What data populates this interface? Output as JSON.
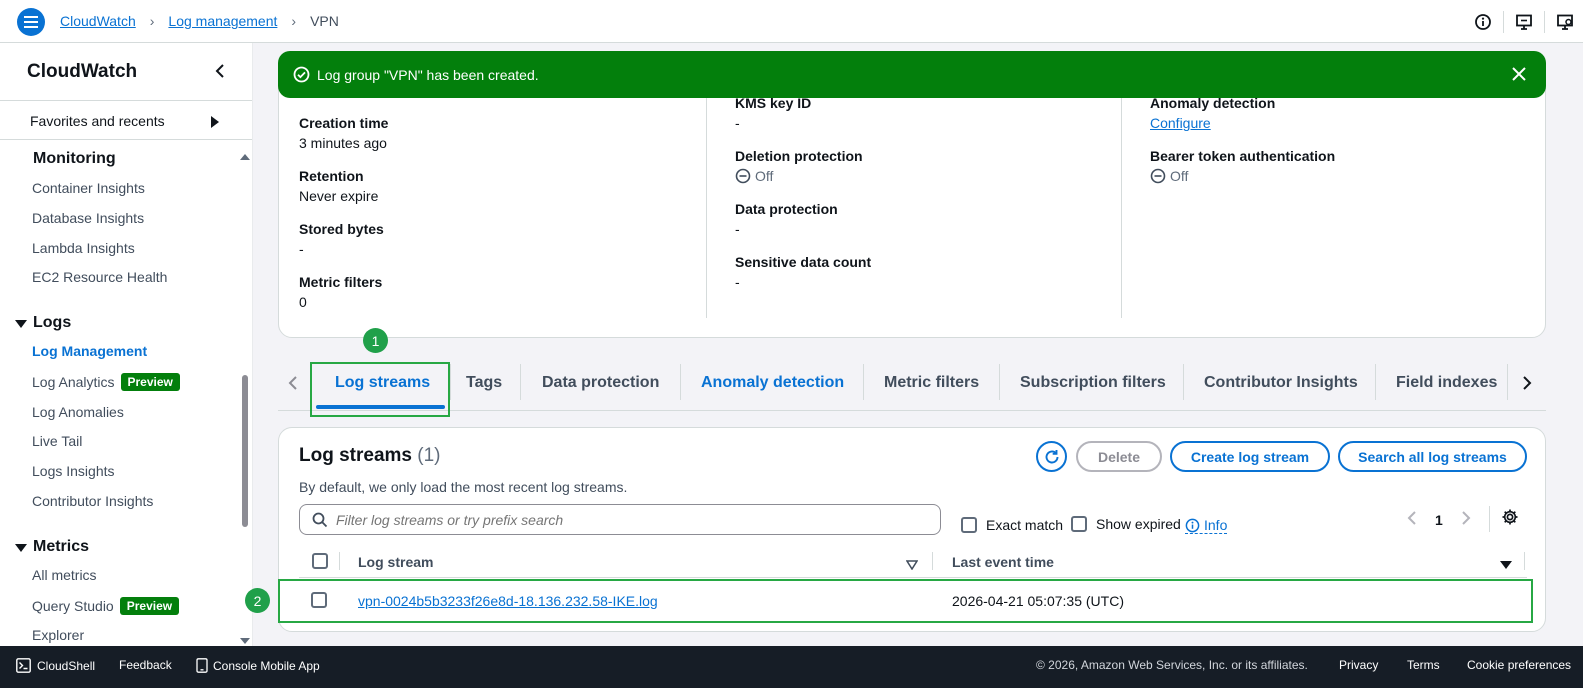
{
  "breadcrumb": [
    "CloudWatch",
    "Log management",
    "VPN"
  ],
  "sidebar": {
    "title": "CloudWatch",
    "favorites": "Favorites and recents",
    "monitoring": {
      "heading": "Monitoring",
      "items": [
        "Container Insights",
        "Database Insights",
        "Lambda Insights",
        "EC2 Resource Health"
      ]
    },
    "logs": {
      "heading": "Logs",
      "items": [
        "Log Management",
        "Log Analytics",
        "Log Anomalies",
        "Live Tail",
        "Logs Insights",
        "Contributor Insights"
      ]
    },
    "metrics": {
      "heading": "Metrics",
      "items": [
        "All metrics",
        "Query Studio",
        "Explorer"
      ]
    },
    "preview_badge": "Preview"
  },
  "flash": {
    "message": "Log group \"VPN\" has been created."
  },
  "details": {
    "col1": [
      {
        "label": "Creation time",
        "value": "3 minutes ago"
      },
      {
        "label": "Retention",
        "value": "Never expire"
      },
      {
        "label": "Stored bytes",
        "value": "-"
      },
      {
        "label": "Metric filters",
        "value": "0"
      }
    ],
    "col2": [
      {
        "label": "KMS key ID",
        "value": "-"
      },
      {
        "label": "Deletion protection",
        "value": "Off"
      },
      {
        "label": "Data protection",
        "value": "-"
      },
      {
        "label": "Sensitive data count",
        "value": "-"
      }
    ],
    "col3": [
      {
        "label": "Anomaly detection",
        "value": "Configure"
      },
      {
        "label": "Bearer token authentication",
        "value": "Off"
      }
    ]
  },
  "tabs": [
    "Log streams",
    "Tags",
    "Data protection",
    "Anomaly detection",
    "Metric filters",
    "Subscription filters",
    "Contributor Insights",
    "Field indexes"
  ],
  "step_badges": [
    "1",
    "2"
  ],
  "log_streams": {
    "title": "Log streams",
    "count": "(1)",
    "description": "By default, we only load the most recent log streams.",
    "buttons": {
      "delete": "Delete",
      "create": "Create log stream",
      "search_all": "Search all log streams"
    },
    "search_placeholder": "Filter log streams or try prefix search",
    "exact_match": "Exact match",
    "show_expired": "Show expired",
    "info": "Info",
    "page": "1",
    "columns": [
      "Log stream",
      "Last event time"
    ],
    "rows": [
      {
        "stream": "vpn-0024b5b3233f26e8d-18.136.232.58-IKE.log",
        "last_event": "2026-04-21 05:07:35 (UTC)"
      }
    ]
  },
  "footer": {
    "cloudshell": "CloudShell",
    "feedback": "Feedback",
    "mobile_app": "Console Mobile App",
    "copyright": "© 2026, Amazon Web Services, Inc. or its affiliates.",
    "privacy": "Privacy",
    "terms": "Terms",
    "cookies": "Cookie preferences"
  },
  "colors": {
    "accent": "#0972d3",
    "success": "#037f0c",
    "highlight": "#27a844",
    "footer_bg": "#161d26"
  }
}
